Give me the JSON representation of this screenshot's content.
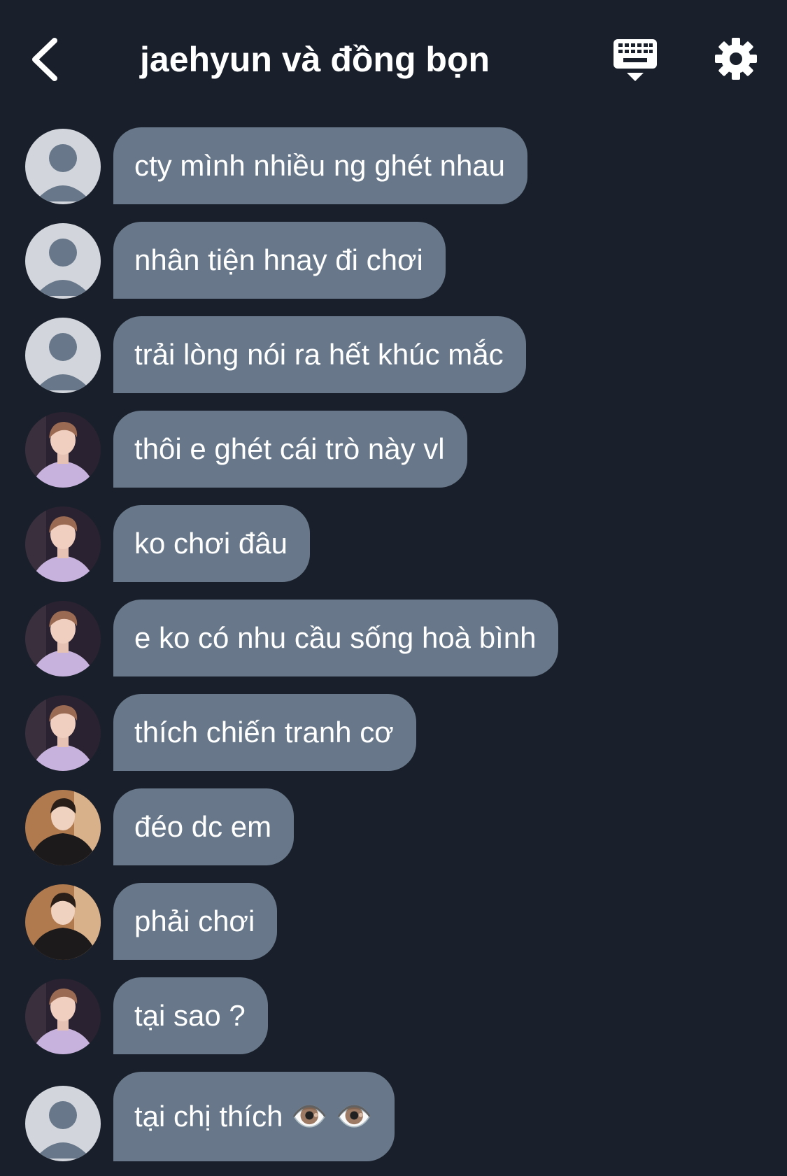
{
  "header": {
    "title": "jaehyun và đồng bọn"
  },
  "colors": {
    "background": "#1a202b",
    "bubble": "#68788a",
    "text": "#ffffff",
    "default_avatar_bg": "#d2d6dc",
    "default_avatar_fg": "#68788a"
  },
  "messages": [
    {
      "avatar": "default-avatar",
      "text": "cty mình nhiều ng ghét nhau"
    },
    {
      "avatar": "default-avatar",
      "text": "nhân tiện hnay đi chơi"
    },
    {
      "avatar": "default-avatar",
      "text": "trải lòng nói ra hết khúc mắc"
    },
    {
      "avatar": "photo-avatar-lavender",
      "text": "thôi e ghét cái trò này vl"
    },
    {
      "avatar": "photo-avatar-lavender",
      "text": "ko chơi đâu"
    },
    {
      "avatar": "photo-avatar-lavender",
      "text": "e ko có nhu cầu sống hoà bình"
    },
    {
      "avatar": "photo-avatar-lavender",
      "text": "thích chiến tranh cơ"
    },
    {
      "avatar": "photo-avatar-black-hoodie",
      "text": "đéo dc em"
    },
    {
      "avatar": "photo-avatar-black-hoodie",
      "text": "phải chơi"
    },
    {
      "avatar": "photo-avatar-lavender",
      "text": "tại sao ?"
    },
    {
      "avatar": "default-avatar",
      "text": "tại chị thích 👁️ 👁️"
    }
  ]
}
